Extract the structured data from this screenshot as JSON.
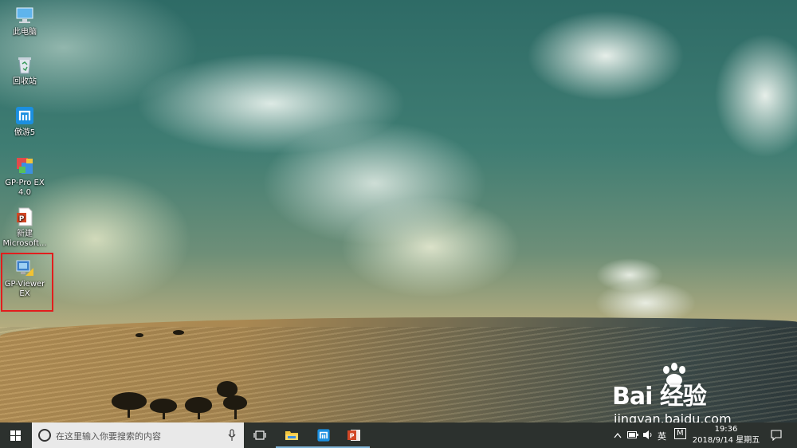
{
  "desktop": {
    "icons": [
      {
        "label": "此电脑",
        "icon": "computer-icon"
      },
      {
        "label": "回收站",
        "icon": "recycle-bin-icon"
      },
      {
        "label": "傲游5",
        "icon": "maxthon-icon"
      },
      {
        "label": "GP-Pro EX 4.0",
        "icon": "gp-pro-ex-icon"
      },
      {
        "label": "新建 Microsoft...",
        "icon": "powerpoint-file-icon"
      },
      {
        "label": "GP-Viewer EX",
        "icon": "gp-viewer-ex-icon"
      }
    ],
    "selected_icon": "GP-Viewer EX",
    "highlight_color": "#e21d1d"
  },
  "taskbar": {
    "search_placeholder": "在这里输入你要搜索的内容",
    "pinned": [
      {
        "name": "task-view",
        "icon": "task-view-icon"
      },
      {
        "name": "file-explorer",
        "icon": "folder-icon"
      },
      {
        "name": "maxthon",
        "icon": "maxthon-icon"
      },
      {
        "name": "powerpoint",
        "icon": "powerpoint-icon"
      }
    ],
    "tray": {
      "ime": "英",
      "ime_mode": "M",
      "time": "19:36",
      "date": "2018/9/14 星期五"
    },
    "accent": "#7fb5d8"
  },
  "watermark": {
    "brand": "Bai 经验",
    "url": "jingyan.baidu.com"
  }
}
